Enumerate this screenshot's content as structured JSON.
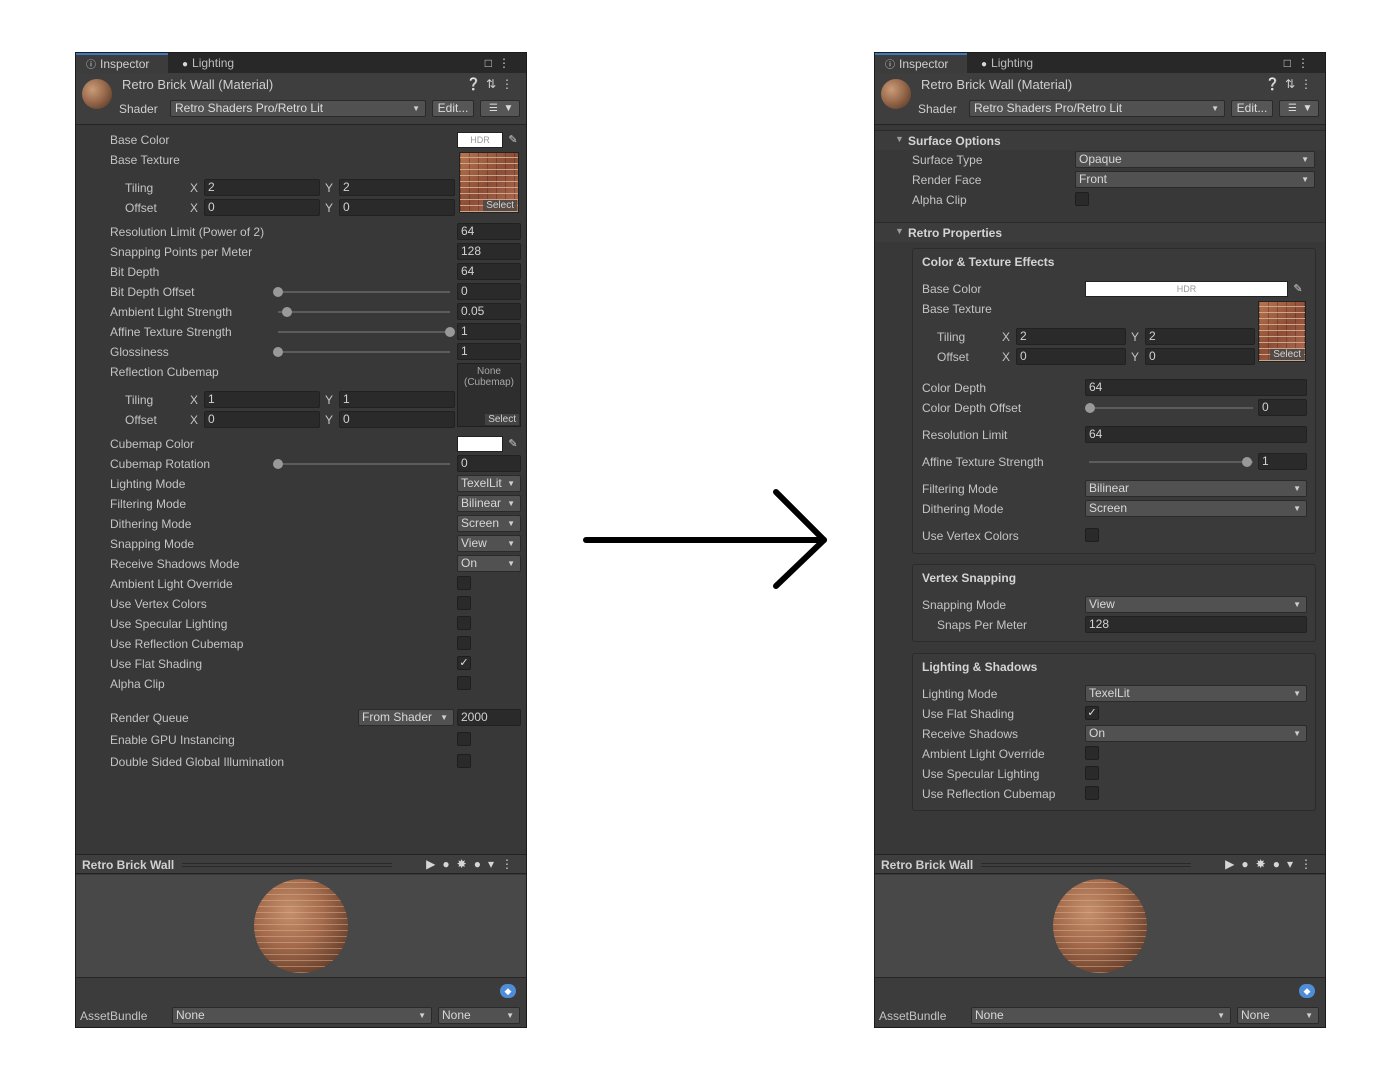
{
  "tabs": {
    "inspector": "Inspector",
    "lighting": "Lighting"
  },
  "header": {
    "material_title": "Retro Brick Wall (Material)",
    "shader_label": "Shader",
    "shader_value": "Retro Shaders Pro/Retro Lit",
    "edit_label": "Edit..."
  },
  "left": {
    "base_color": "Base Color",
    "hdr": "HDR",
    "base_texture": "Base Texture",
    "tiling": "Tiling",
    "offset": "Offset",
    "x": "X",
    "y": "Y",
    "tiling_x": "2",
    "tiling_y": "2",
    "offset_x": "0",
    "offset_y": "0",
    "select": "Select",
    "resolution_limit": "Resolution Limit (Power of 2)",
    "resolution_limit_value": "64",
    "snapping_points": "Snapping Points per Meter",
    "snapping_points_value": "128",
    "bit_depth": "Bit Depth",
    "bit_depth_value": "64",
    "bit_depth_offset": "Bit Depth Offset",
    "bit_depth_offset_value": "0",
    "ambient_light_strength": "Ambient Light Strength",
    "ambient_light_strength_value": "0.05",
    "affine_texture_strength": "Affine Texture Strength",
    "affine_texture_strength_value": "1",
    "glossiness": "Glossiness",
    "glossiness_value": "1",
    "reflection_cubemap": "Reflection Cubemap",
    "cubemap_none_1": "None",
    "cubemap_none_2": "(Cubemap)",
    "cube_tiling_x": "1",
    "cube_tiling_y": "1",
    "cube_offset_x": "0",
    "cube_offset_y": "0",
    "cubemap_color": "Cubemap Color",
    "cubemap_rotation": "Cubemap Rotation",
    "cubemap_rotation_value": "0",
    "lighting_mode": "Lighting Mode",
    "lighting_mode_value": "TexelLit",
    "filtering_mode": "Filtering Mode",
    "filtering_mode_value": "Bilinear",
    "dithering_mode": "Dithering Mode",
    "dithering_mode_value": "Screen",
    "snapping_mode": "Snapping Mode",
    "snapping_mode_value": "View",
    "receive_shadows_mode": "Receive Shadows Mode",
    "receive_shadows_mode_value": "On",
    "ambient_light_override": "Ambient Light Override",
    "use_vertex_colors": "Use Vertex Colors",
    "use_specular_lighting": "Use Specular Lighting",
    "use_reflection_cubemap": "Use Reflection Cubemap",
    "use_flat_shading": "Use Flat Shading",
    "alpha_clip": "Alpha Clip",
    "render_queue": "Render Queue",
    "render_queue_dd": "From Shader",
    "render_queue_value": "2000",
    "enable_gpu_instancing": "Enable GPU Instancing",
    "double_sided_gi": "Double Sided Global Illumination",
    "slider_levels": {
      "bit_depth_offset": 0,
      "ambient_light_strength": 0.05,
      "affine_texture_strength": 1,
      "glossiness": 0,
      "cubemap_rotation": 0
    }
  },
  "right": {
    "surface_options": "Surface Options",
    "surface_type": "Surface Type",
    "surface_type_value": "Opaque",
    "render_face": "Render Face",
    "render_face_value": "Front",
    "alpha_clip": "Alpha Clip",
    "retro_properties": "Retro Properties",
    "color_texture_effects": "Color & Texture Effects",
    "base_color": "Base Color",
    "hdr": "HDR",
    "base_texture": "Base Texture",
    "tiling": "Tiling",
    "offset": "Offset",
    "x": "X",
    "y": "Y",
    "tiling_x": "2",
    "tiling_y": "2",
    "offset_x": "0",
    "offset_y": "0",
    "select": "Select",
    "color_depth": "Color Depth",
    "color_depth_value": "64",
    "color_depth_offset": "Color Depth Offset",
    "color_depth_offset_value": "0",
    "resolution_limit": "Resolution Limit",
    "resolution_limit_value": "64",
    "affine_texture_strength": "Affine Texture Strength",
    "affine_texture_strength_value": "1",
    "filtering_mode": "Filtering Mode",
    "filtering_mode_value": "Bilinear",
    "dithering_mode": "Dithering Mode",
    "dithering_mode_value": "Screen",
    "use_vertex_colors": "Use Vertex Colors",
    "vertex_snapping": "Vertex Snapping",
    "snapping_mode": "Snapping Mode",
    "snapping_mode_value": "View",
    "snaps_per_meter": "Snaps Per Meter",
    "snaps_per_meter_value": "128",
    "lighting_shadows": "Lighting & Shadows",
    "lighting_mode": "Lighting Mode",
    "lighting_mode_value": "TexelLit",
    "use_flat_shading": "Use Flat Shading",
    "receive_shadows": "Receive Shadows",
    "receive_shadows_value": "On",
    "ambient_light_override": "Ambient Light Override",
    "use_specular_lighting": "Use Specular Lighting",
    "use_reflection_cubemap": "Use Reflection Cubemap",
    "slider_levels": {
      "color_depth_offset": 0,
      "affine_texture_strength": 1
    }
  },
  "preview": {
    "title": "Retro Brick Wall"
  },
  "footer": {
    "asset_bundle_label": "AssetBundle",
    "bundle_value": "None",
    "variant_value": "None"
  },
  "colors": {
    "panel_bg": "#383838",
    "field_bg": "#2a2a2a",
    "accent": "#3a79bb",
    "text": "#c4c4c4"
  },
  "icons": [
    "info-icon",
    "lightbulb-icon",
    "lock-icon",
    "kebab-menu-icon",
    "help-icon",
    "preset-icon",
    "eyedropper-icon",
    "play-icon",
    "sphere-icon",
    "light-icon",
    "tag-icon",
    "arrow-icon"
  ]
}
